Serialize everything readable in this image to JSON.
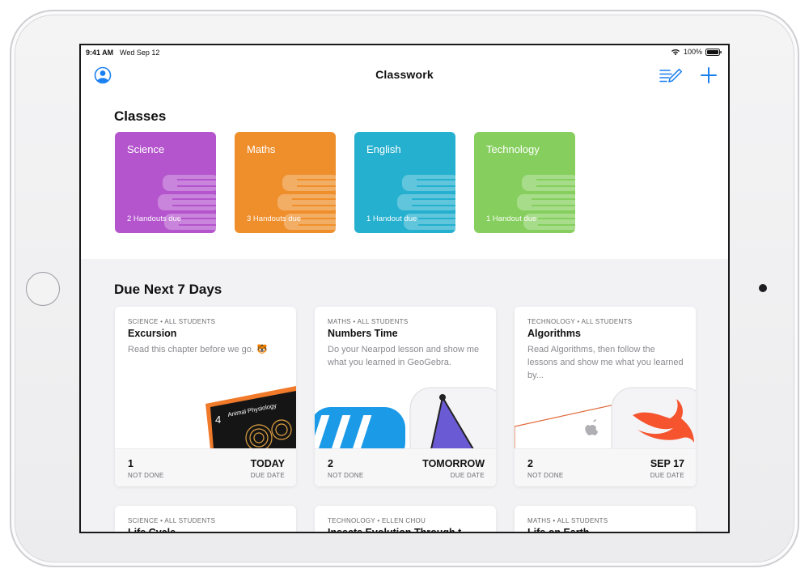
{
  "status_bar": {
    "time": "9:41 AM",
    "date": "Wed Sep 12",
    "battery": "100%"
  },
  "nav": {
    "title": "Classwork",
    "icons": [
      "profile-icon",
      "compose-icon",
      "add-icon"
    ]
  },
  "classes": {
    "title": "Classes",
    "items": [
      {
        "name": "Science",
        "handouts": "2 Handouts due",
        "color": "#b455cd"
      },
      {
        "name": "Maths",
        "handouts": "3 Handouts due",
        "color": "#ef8f2c"
      },
      {
        "name": "English",
        "handouts": "1 Handout due",
        "color": "#25b0cf"
      },
      {
        "name": "Technology",
        "handouts": "1 Handout due",
        "color": "#86cf5e"
      }
    ]
  },
  "due": {
    "title": "Due Next 7 Days",
    "cards": [
      {
        "meta": "SCIENCE • ALL STUDENTS",
        "title": "Excursion",
        "description": "Read this chapter before we go. 🐯",
        "count": "1",
        "count_label": "NOT DONE",
        "date": "TODAY",
        "date_label": "DUE DATE",
        "book_number": "4",
        "book_title": "Animal Physiology"
      },
      {
        "meta": "MATHS • ALL STUDENTS",
        "title": "Numbers Time",
        "description": "Do your Nearpod lesson and show me what you learned in GeoGebra.",
        "count": "2",
        "count_label": "NOT DONE",
        "date": "TOMORROW",
        "date_label": "DUE DATE"
      },
      {
        "meta": "TECHNOLOGY • ALL STUDENTS",
        "title": "Algorithms",
        "description": "Read Algorithms, then follow the lessons and show me what you learned by...",
        "count": "2",
        "count_label": "NOT DONE",
        "date": "SEP 17",
        "date_label": "DUE DATE"
      }
    ],
    "next_cards": [
      {
        "meta": "SCIENCE • ALL STUDENTS",
        "title": "Life Cycle"
      },
      {
        "meta": "TECHNOLOGY • ELLEN CHOU",
        "title": "Insects Evolution Through t"
      },
      {
        "meta": "MATHS • ALL STUDENTS",
        "title": "Life on Earth"
      }
    ]
  }
}
